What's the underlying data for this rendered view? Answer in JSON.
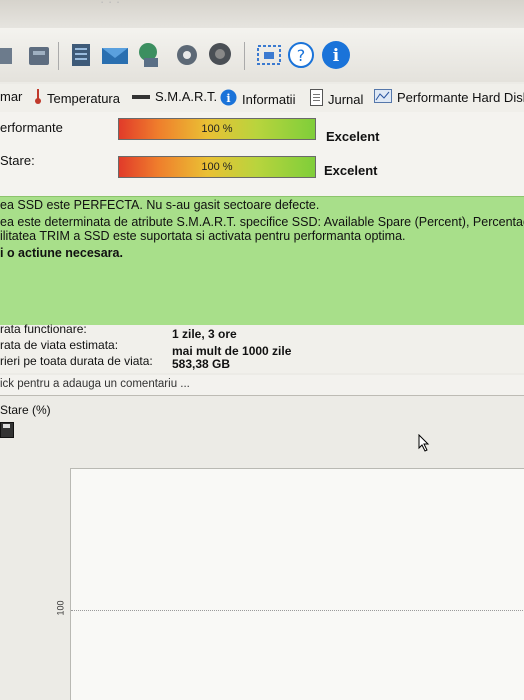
{
  "toolbar": {
    "icons": [
      "warning-icon",
      "disk-icon",
      "notes-icon",
      "mail-icon",
      "network-icon",
      "settings-icon",
      "speaker-icon",
      "screenshot-icon",
      "help-icon",
      "info-icon"
    ]
  },
  "tabs": [
    {
      "label": "mar"
    },
    {
      "label": "Temperatura"
    },
    {
      "label": "S.M.A.R.T."
    },
    {
      "label": "Informatii"
    },
    {
      "label": "Jurnal"
    },
    {
      "label": "Performante Hard Disk"
    }
  ],
  "status": {
    "performance": {
      "label": "erformante",
      "percent_text": "100 %",
      "percent": 100,
      "rating": "Excelent"
    },
    "health": {
      "label": "Stare:",
      "percent_text": "100 %",
      "percent": 100,
      "rating": "Excelent"
    }
  },
  "message": {
    "line1": "ea SSD este PERFECTA. Nu s-au gasit sectoare defecte.",
    "line2": "ea este determinata de atribute S.M.A.R.T. specifice SSD: Available Spare (Percent), Percentage U",
    "line3": "ilitatea TRIM a SSD este suportata si activata pentru performanta optima.",
    "action": "i o actiune necesara."
  },
  "info": {
    "rows": [
      {
        "key": "rata functionare:",
        "value": "1 zile, 3 ore"
      },
      {
        "key": "rata de viata estimata:",
        "value": "mai mult de 1000 zile"
      },
      {
        "key": "rieri pe toata durata de viata:",
        "value": "583,38 GB"
      }
    ]
  },
  "comment": {
    "placeholder": "ick pentru a adauga un comentariu ..."
  },
  "chart": {
    "title": "Stare (%)",
    "ytick": "100"
  },
  "colors": {
    "green_panel": "#a8df8a",
    "accent": "#1a73d9"
  }
}
